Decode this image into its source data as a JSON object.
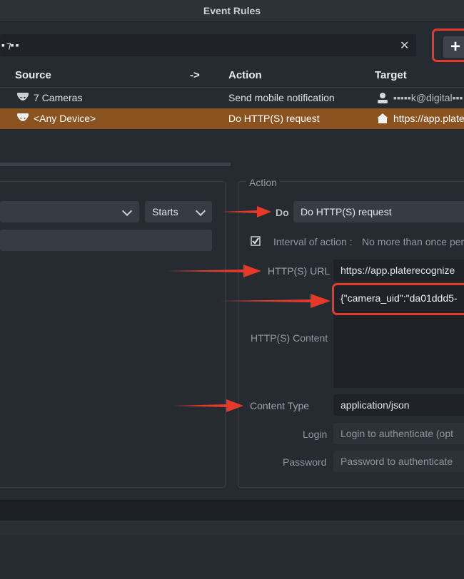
{
  "window": {
    "title": "Event Rules"
  },
  "search": {
    "value": "▪ ⁊▪ ▪"
  },
  "toolbar": {
    "add_label": "+"
  },
  "table": {
    "columns": [
      "Source",
      "->",
      "Action",
      "Target"
    ],
    "rows": [
      {
        "source": "7 Cameras",
        "action": "Send mobile notification",
        "target": "▪▪▪▪▪k@digital▪▪▪"
      },
      {
        "source": "<Any Device>",
        "action": "Do HTTP(S) request",
        "target": "https://app.plate"
      }
    ]
  },
  "event": {
    "starts_label": "Starts"
  },
  "action": {
    "legend": "Action",
    "do_label": "Do",
    "do_value": "Do HTTP(S) request",
    "interval_label": "Interval of action :",
    "interval_value": "No more than once per",
    "url_label": "HTTP(S) URL",
    "url_value": "https://app.platerecognize",
    "content_label": "HTTP(S) Content",
    "content_value": "{\"camera_uid\":\"da01ddd5-",
    "content_type_label": "Content Type",
    "content_type_value": "application/json",
    "login_label": "Login",
    "login_placeholder": "Login to authenticate (opt",
    "password_label": "Password",
    "password_placeholder": "Password to authenticate"
  },
  "colors": {
    "accent_red": "#e53a2a",
    "selected_row": "#8a5320",
    "panel_bg": "#262b31"
  }
}
